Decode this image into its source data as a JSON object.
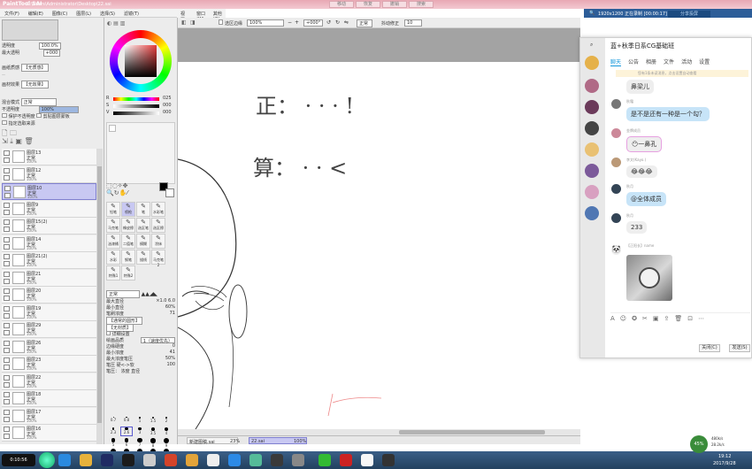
{
  "app": {
    "logo": "PaintTool SAI",
    "path": "C:\\Users\\Administrator\\Desktop\\22.sai",
    "title_tabs": [
      "移动",
      "恢复",
      "撤销",
      "搜索"
    ],
    "window_buttons": [
      "_",
      "□",
      "×"
    ]
  },
  "recording_bar": {
    "text": "1920x1200  正在录制 [00:00:17]",
    "button": "分享投屏"
  },
  "menu": [
    "文件(F)",
    "编辑(E)",
    "图像(C)",
    "图层(L)",
    "选择(S)",
    "滤镜(T)",
    "视图(V)",
    "窗口(W)",
    "其他(O)"
  ],
  "layers_panel": {
    "opacity_label": "透明度",
    "opacity_value": "100.0%",
    "hardness_label": "最大透明",
    "hardness_value": "+000",
    "texture_label": "画纸质感",
    "texture_value": "【无质感】",
    "effect_label": "画材效果",
    "effect_value": "【无效果】",
    "mode_label": "混合模式",
    "mode_value": "正常",
    "opacity2_label": "不透明度",
    "opacity2_value": "100%",
    "protect_label": "保护不透明度",
    "clip_label": "剪贴图层蒙板",
    "select_label": "指定选取来源",
    "layers": [
      {
        "name": "图层13",
        "mode": "正常",
        "opacity": "100%"
      },
      {
        "name": "图层12",
        "mode": "正常",
        "opacity": "100%"
      },
      {
        "name": "图层10",
        "mode": "正常",
        "opacity": "100%"
      },
      {
        "name": "图层9",
        "mode": "正常",
        "opacity": "100%"
      },
      {
        "name": "图层15(2)",
        "mode": "正常",
        "opacity": "100%"
      },
      {
        "name": "图层14",
        "mode": "正常",
        "opacity": "100%"
      },
      {
        "name": "图层21(2)",
        "mode": "正常",
        "opacity": "100%"
      },
      {
        "name": "图层21",
        "mode": "正常",
        "opacity": "100%"
      },
      {
        "name": "图层20",
        "mode": "正常",
        "opacity": "100%"
      },
      {
        "name": "图层19",
        "mode": "正常",
        "opacity": "100%"
      },
      {
        "name": "图层29",
        "mode": "正常",
        "opacity": "100%"
      },
      {
        "name": "图层26",
        "mode": "正常",
        "opacity": "100%"
      },
      {
        "name": "图层23",
        "mode": "正常",
        "opacity": "100%"
      },
      {
        "name": "图层22",
        "mode": "正常",
        "opacity": "100%"
      },
      {
        "name": "图层18",
        "mode": "正常",
        "opacity": "100%"
      },
      {
        "name": "图层17",
        "mode": "正常",
        "opacity": "100%"
      },
      {
        "name": "图层16",
        "mode": "正常",
        "opacity": "100%"
      }
    ]
  },
  "tool_panel": {
    "hsv": [
      {
        "label": "R",
        "value": "025"
      },
      {
        "label": "S",
        "value": "000"
      },
      {
        "label": "V",
        "value": "000"
      }
    ],
    "tools": [
      "铅笔",
      "喷枪",
      "笔",
      "水彩笔",
      "马克笔",
      "橡皮擦",
      "选区笔",
      "选区擦",
      "油漆桶",
      "二值笔",
      "模糊",
      "涂抹",
      "水彩",
      "钢笔",
      "描线",
      "马克笔2",
      "特殊1",
      "特殊2"
    ],
    "blend_mode": "正常",
    "max_size_label": "最大直径",
    "max_size_value": "×1.0  6.0",
    "min_size_label": "最小直径",
    "min_size_value": "60%",
    "density_label": "笔刷浓度",
    "density_value": "71",
    "shape_label": "【通常的圆形】",
    "texture_label": "【无材质】",
    "detail_label": "详细设置",
    "quality_label": "绘画品质",
    "quality_value": "1（速度优先）",
    "edge_label": "边缘硬度",
    "edge_value": "0",
    "min_density_label": "最小浓度",
    "min_density_value": "41",
    "max_pressure_label": "最大浓度笔压",
    "max_pressure_value": "50%",
    "pressure_label": "笔压  硬<->软",
    "pressure_value": "100",
    "pressure_opts": "笔压： 浓度  直径",
    "brush_sizes": [
      "0.7",
      "0.8",
      "1",
      "1.5",
      "2",
      "2.3",
      "2.6",
      "3",
      "3.5",
      "4",
      "5",
      "6",
      "7",
      "8",
      "9",
      "10",
      "12",
      "14",
      "16",
      "20"
    ]
  },
  "canvas": {
    "select_label": "选区边缘",
    "zoom": "100%",
    "angle": "+000°",
    "mode": "正常",
    "stabilizer_label": "抖动修正",
    "stabilizer_value": "10",
    "strokes_text_1": "正：  ·  ·  ·  !",
    "strokes_text_2": "算：  ·  ·  <"
  },
  "status": {
    "file1": "新建图稿.sai",
    "zoom1": "23%",
    "file2": "22.sai",
    "zoom2": "100%"
  },
  "qq_window": {
    "title": "蓝+秋季日系CG基础班",
    "tabs": [
      "聊天",
      "公告",
      "相册",
      "文件",
      "活动",
      "设置"
    ],
    "notice": "您有1条未读消息，点击设置自动查看",
    "messages": [
      {
        "type": "bubble",
        "text": "鼻梁儿",
        "color": "grey"
      },
      {
        "sender": "秋霜",
        "type": "bubble",
        "text": "是不是还有一种是一个勾？",
        "color": "blue"
      },
      {
        "sender": "金牌成员",
        "type": "bubble",
        "text": "😶一鼻孔",
        "color": "grey"
      },
      {
        "sender": "李文(Kayo.)",
        "type": "bubble",
        "text": "😂😂😂",
        "color": "grey"
      },
      {
        "sender": "秋月",
        "type": "bubble",
        "text": "@全体成员",
        "color": "blue"
      },
      {
        "sender": "秋月",
        "type": "bubble",
        "text": "233",
        "color": "grey"
      },
      {
        "sender": "【正阳长】name",
        "type": "image",
        "text": ""
      }
    ],
    "close_button": "关闭(C)",
    "send_button": "发送(S)"
  },
  "taskbar": {
    "start": "",
    "network": "45%",
    "speed_up": "480k/s",
    "speed_down": "28.2k/s",
    "time": "19:12",
    "date": "2017/9/28",
    "recording_label": "0:10:56"
  }
}
